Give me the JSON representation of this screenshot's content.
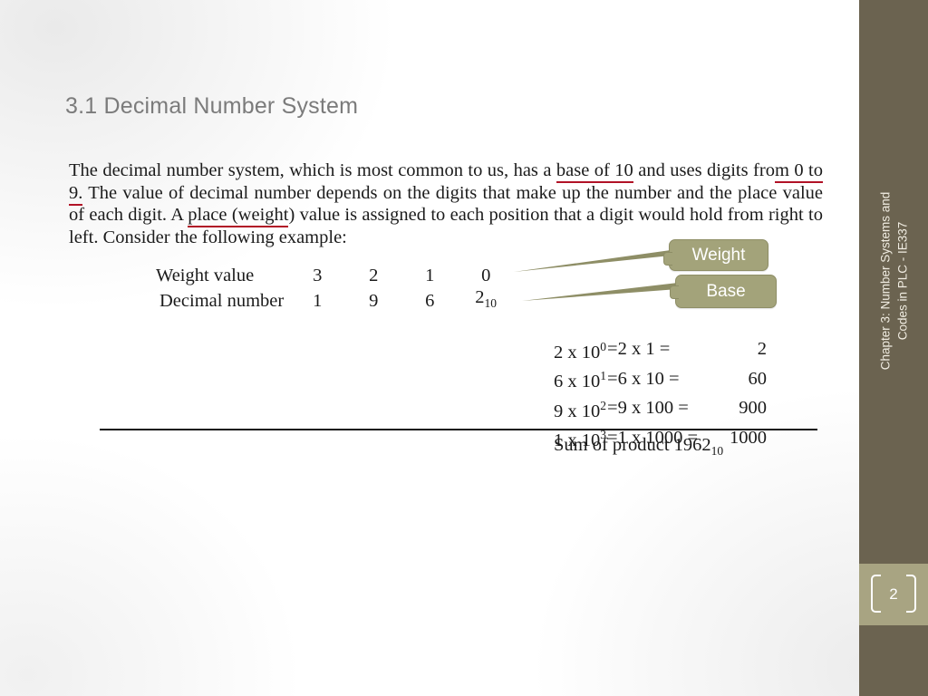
{
  "slide": {
    "title": "3.1 Decimal Number System",
    "paragraph": {
      "seg1": "The decimal number system, which is most common to us, has a ",
      "underline1": "base of 10",
      "seg2": " and uses digits fro",
      "underline2": "m 0 to 9.",
      "seg3": " The value of decimal number depends on the digits that make up the number and the place value of each digit. A ",
      "underline3": "place (weight",
      "seg4": ") value is assigned to each position that a digit would hold from right to left. Consider the following example:"
    },
    "number_table": {
      "row_weight_label": "Weight value",
      "row_weight_digits": [
        "3",
        "2",
        "1",
        "0"
      ],
      "row_decimal_label": "Decimal number",
      "row_decimal_digits": [
        "1",
        "9",
        "6",
        "2"
      ],
      "decimal_subscript": "10"
    },
    "callouts": {
      "weight": "Weight",
      "base": "Base"
    },
    "calculation": {
      "rows": [
        {
          "expr": "2 x 10",
          "exp": "0",
          "eqn": "=2 x 1  =",
          "result": "2"
        },
        {
          "expr": "6 x 10",
          "exp": "1",
          "eqn": "=6 x 10 =",
          "result": "60"
        },
        {
          "expr": "9 x 10",
          "exp": "2",
          "eqn": "=9 x 100 =",
          "result": "900"
        },
        {
          "expr": "1 x 10",
          "exp": "3",
          "eqn": "=1 x 1000 =",
          "result": "1000"
        }
      ],
      "sum_label": "Sum of product ",
      "sum_value": "1962",
      "sum_subscript": "10"
    },
    "sidebar": {
      "line1": "Chapter 3: Number Systems and",
      "line2": "Codes in PLC - IE337",
      "page_number": "2"
    },
    "colors": {
      "sidebar_bg": "#6b6350",
      "pagenum_band": "#a8a482",
      "callout_bg": "#a3a37a",
      "underline_red": "#b11226",
      "title_gray": "#7b7b7b"
    }
  }
}
